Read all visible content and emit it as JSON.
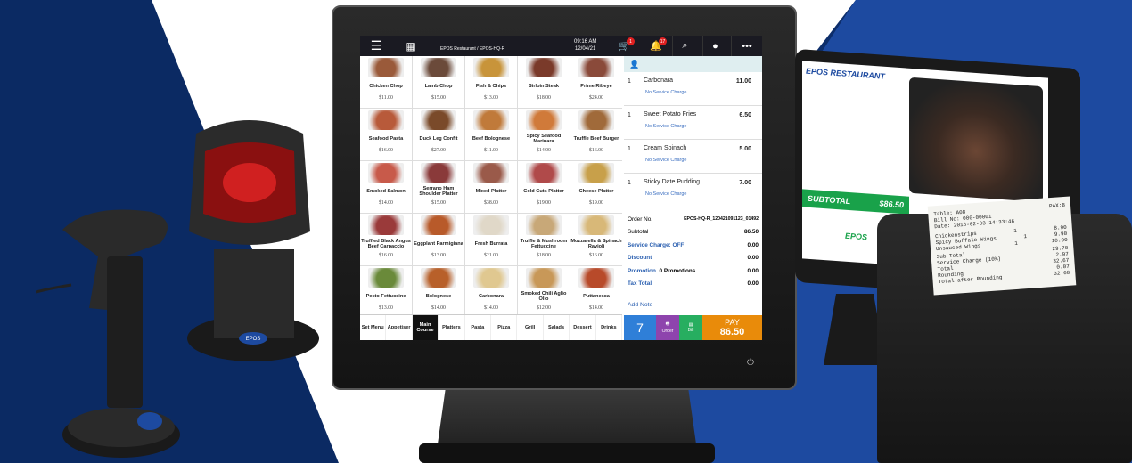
{
  "colors": {
    "navy": "#0b2a63",
    "blue": "#1d4aa0",
    "accent_blue": "#2f7fd8",
    "pay_orange": "#e98b0a",
    "order_purple": "#8e44ad",
    "bill_green": "#27ae60"
  },
  "topbar": {
    "menu_icon": "hamburger-icon",
    "grid_icon": "grid-icon",
    "title": "EPOS Restaurant / EPOS-HQ-R",
    "time": "09:16 AM",
    "date": "12/04/21",
    "cart_badge": "1",
    "notif_badge": "17"
  },
  "menu_items": [
    {
      "name": "Chicken Chop",
      "price": "$11.00",
      "color": "#9a5a3a"
    },
    {
      "name": "Lamb Chop",
      "price": "$15.00",
      "color": "#6b4a3a"
    },
    {
      "name": "Fish & Chips",
      "price": "$13.00",
      "color": "#c8943a"
    },
    {
      "name": "Sirloin Steak",
      "price": "$18.00",
      "color": "#7a3a2a"
    },
    {
      "name": "Prime Ribeye",
      "price": "$24.00",
      "color": "#8a4a3a"
    },
    {
      "name": "Seafood Pasta",
      "price": "$16.00",
      "color": "#b85a3a"
    },
    {
      "name": "Duck Leg Confit",
      "price": "$27.00",
      "color": "#7a4a2a"
    },
    {
      "name": "Beef Bolognese",
      "price": "$11.00",
      "color": "#c07a3a"
    },
    {
      "name": "Spicy Seafood Marinara",
      "price": "$14.00",
      "color": "#d07a3a"
    },
    {
      "name": "Truffle Beef Burger",
      "price": "$16.00",
      "color": "#a06a3a"
    },
    {
      "name": "Smoked Salmon",
      "price": "$14.00",
      "color": "#c85a4a"
    },
    {
      "name": "Serrano Ham Shoulder Platter",
      "price": "$15.00",
      "color": "#8a3a3a"
    },
    {
      "name": "Mixed Platter",
      "price": "$38.00",
      "color": "#9a5a4a"
    },
    {
      "name": "Cold Cuts Platter",
      "price": "$19.00",
      "color": "#b04a4a"
    },
    {
      "name": "Cheese Platter",
      "price": "$19.00",
      "color": "#c8a04a"
    },
    {
      "name": "Truffled Black Angus Beef Carpaccio",
      "price": "$16.00",
      "color": "#9a3a3a"
    },
    {
      "name": "Eggplant Parmigiana",
      "price": "$13.00",
      "color": "#b85a2a"
    },
    {
      "name": "Fresh Burrata",
      "price": "$21.00",
      "color": "#e0d8c8"
    },
    {
      "name": "Truffle & Mushroom Fettuccine",
      "price": "$18.00",
      "color": "#c8a878"
    },
    {
      "name": "Mozzarella & Spinach Ravioli",
      "price": "$16.00",
      "color": "#d8b878"
    },
    {
      "name": "Pesto Fettuccine",
      "price": "$13.00",
      "color": "#6a8a3a"
    },
    {
      "name": "Bolognese",
      "price": "$14.00",
      "color": "#b8602a"
    },
    {
      "name": "Carbonara",
      "price": "$14.00",
      "color": "#e0c890"
    },
    {
      "name": "Smoked Chili Aglio Olio",
      "price": "$12.00",
      "color": "#c89858"
    },
    {
      "name": "Puttanesca",
      "price": "$14.00",
      "color": "#b84a2a"
    }
  ],
  "categories": [
    {
      "label": "Set Menu",
      "active": false
    },
    {
      "label": "Appetiser",
      "active": false
    },
    {
      "label": "Main Course",
      "active": true
    },
    {
      "label": "Platters",
      "active": false
    },
    {
      "label": "Pasta",
      "active": false
    },
    {
      "label": "Pizza",
      "active": false
    },
    {
      "label": "Grill",
      "active": false
    },
    {
      "label": "Salads",
      "active": false
    },
    {
      "label": "Dessert",
      "active": false
    },
    {
      "label": "Drinks",
      "active": false
    }
  ],
  "order": {
    "header_icon": "user-icon",
    "lines": [
      {
        "qty": "1",
        "name": "Carbonara",
        "amount": "11.00",
        "note": "No Service Charge"
      },
      {
        "qty": "1",
        "name": "Sweet Potato Fries",
        "amount": "6.50",
        "note": "No Service Charge"
      },
      {
        "qty": "1",
        "name": "Cream Spinach",
        "amount": "5.00",
        "note": "No Service Charge"
      },
      {
        "qty": "1",
        "name": "Sticky Date Pudding",
        "amount": "7.00",
        "note": "No Service Charge"
      }
    ],
    "order_no_label": "Order No.",
    "order_no": "EPOS-HQ-R_120421091123_01492",
    "subtotal_label": "Subtotal",
    "subtotal": "86.50",
    "service_label": "Service Charge: OFF",
    "service": "0.00",
    "discount_label": "Discount",
    "discount": "0.00",
    "promotion_label": "Promotion",
    "promotion_text": "0 Promotions",
    "promotion": "0.00",
    "tax_label": "Tax Total",
    "tax": "0.00",
    "add_note": "Add Note",
    "guests": "7",
    "order_btn": "Order",
    "bill_btn": "Bill",
    "pay_label": "PAY",
    "pay_amount": "86.50"
  },
  "tablet": {
    "brand": "EPOS RESTAURANT",
    "subtotal_label": "SUBTOTAL",
    "subtotal_value": "$86.50",
    "logo": "EPOS"
  },
  "receipt": {
    "table": "Table: A08",
    "pax": "PAX:8",
    "bill_no": "Bill No: 000-00001",
    "date": "Date: 2016-02-03 14:33:46",
    "l1_name": "Chickenstrips",
    "l1_qty": "1",
    "l1_amt": "8.90",
    "l2_name": "Spicy Buffalo Wings",
    "l2_qty": "1",
    "l2_amt": "9.90",
    "l3_name": "Unsauced Wings",
    "l3_qty": "1",
    "l3_amt": "10.90",
    "subtotal_label": "Sub-Total",
    "subtotal": "29.70",
    "service_label": "Service Charge (10%)",
    "service": "2.97",
    "total_label": "Total",
    "total": "32.67",
    "rounding_label": "Rounding",
    "rounding": "0.07",
    "after_label": "Total after Rounding",
    "after": "32.60"
  },
  "scanner": {
    "badge": "EPOS"
  }
}
